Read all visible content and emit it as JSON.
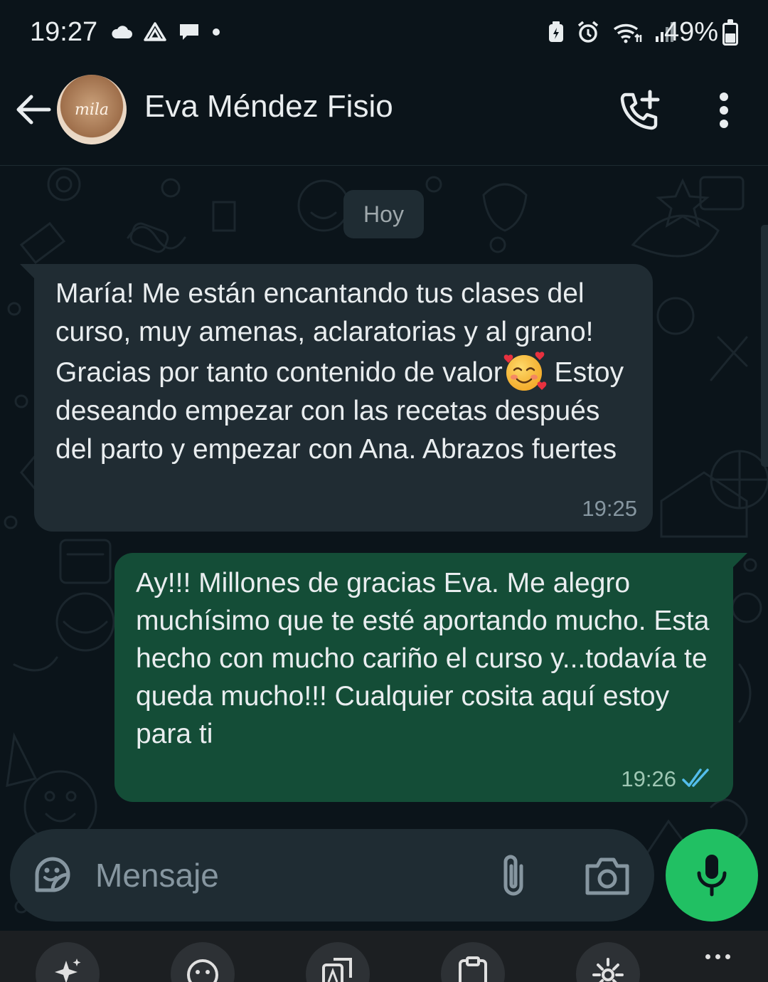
{
  "status_bar": {
    "time": "19:27",
    "battery_percent": "49%",
    "battery_level": 0.49,
    "left_icons": [
      "cloud-icon",
      "drive-icon",
      "chat-bubble-icon",
      "dot-icon"
    ],
    "right_icons": [
      "battery-saver-icon",
      "alarm-icon",
      "wifi-icon",
      "signal-icon"
    ]
  },
  "header": {
    "contact_name": "Eva Méndez Fisio",
    "avatar_text": "mila",
    "actions": [
      "back-arrow-icon",
      "add-call-icon",
      "more-vert-icon"
    ]
  },
  "chat": {
    "date_chip": "Hoy",
    "messages": [
      {
        "direction": "incoming",
        "text_before_emoji": "María! Me están encantando tus clases del curso, muy amenas, aclaratorias y al grano! Gracias por tanto contenido de valor",
        "emoji": "smiling-face-with-hearts-emoji",
        "text_after_emoji": " Estoy deseando empezar con las recetas después del parto y empezar con Ana. Abrazos fuertes",
        "time": "19:25"
      },
      {
        "direction": "outgoing",
        "text": "Ay!!! Millones de gracias Eva. Me alegro muchísimo que te esté aportando mucho. Esta hecho con mucho cariño el curso y...todavía te queda mucho!!! Cualquier cosita aquí estoy para ti",
        "time": "19:26",
        "status": "read"
      }
    ]
  },
  "composer": {
    "placeholder": "Mensaje"
  },
  "keyboard_toolbar": {
    "items": [
      "sparkle-icon",
      "emoji-icon",
      "translate-icon",
      "clipboard-icon",
      "settings-icon",
      "more-horiz-icon"
    ]
  },
  "colors": {
    "background": "#0b141a",
    "incoming_bubble": "#202c33",
    "outgoing_bubble": "#144d37",
    "accent_green": "#21c063",
    "read_ticks": "#53bdeb"
  }
}
